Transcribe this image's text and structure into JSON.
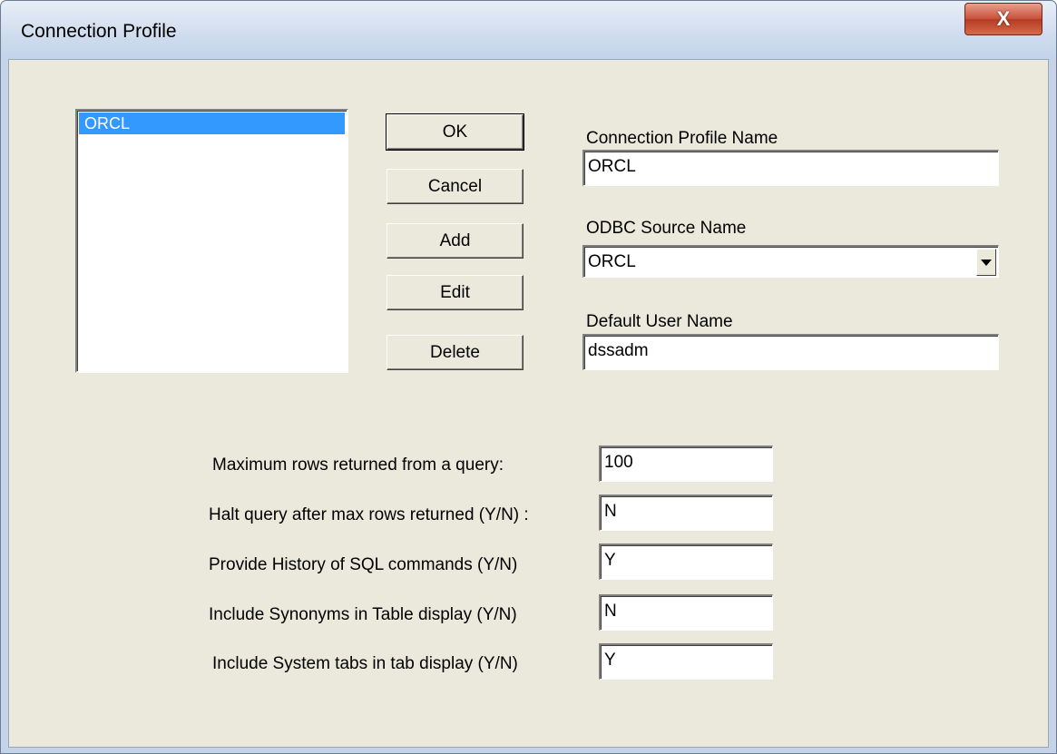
{
  "window": {
    "title": "Connection Profile",
    "close_glyph": "X"
  },
  "profiles_list": {
    "items": [
      "ORCL"
    ],
    "selected": "ORCL"
  },
  "buttons": {
    "ok": "OK",
    "cancel": "Cancel",
    "add": "Add",
    "edit": "Edit",
    "delete": "Delete"
  },
  "profile_form": {
    "name_label": "Connection Profile Name",
    "name_value": "ORCL",
    "odbc_label": "ODBC Source Name",
    "odbc_value": "ORCL",
    "user_label": "Default User Name",
    "user_value": "dssadm"
  },
  "options": [
    {
      "label": "Maximum rows returned from a query:",
      "value": "100"
    },
    {
      "label": "Halt query after max rows returned (Y/N) :",
      "value": "N"
    },
    {
      "label": "Provide History of SQL commands (Y/N)",
      "value": "Y"
    },
    {
      "label": "Include Synonyms in Table display (Y/N)",
      "value": "N"
    },
    {
      "label": "Include System tabs in tab display  (Y/N)",
      "value": "Y"
    }
  ],
  "colors": {
    "dialog_bg": "#ebe9db",
    "selection": "#3399ff",
    "close_button": "#c8503a"
  }
}
